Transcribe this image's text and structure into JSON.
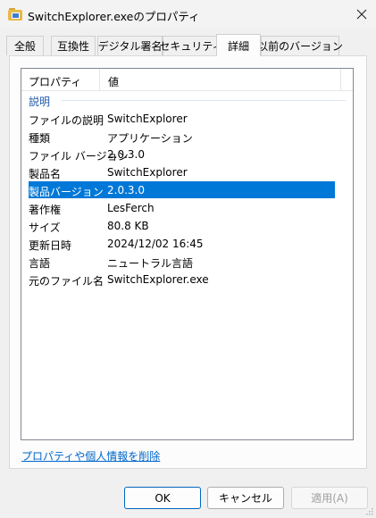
{
  "window": {
    "title": "SwitchExplorer.exeのプロパティ",
    "close_icon": "close-icon",
    "app_icon": "folder-app-icon"
  },
  "tabs": [
    {
      "label": "全般"
    },
    {
      "label": "互換性"
    },
    {
      "label": "デジタル署名"
    },
    {
      "label": "セキュリティ"
    },
    {
      "label": "詳細",
      "active": true
    },
    {
      "label": "以前のバージョン"
    }
  ],
  "details": {
    "header": {
      "property": "プロパティ",
      "value": "値"
    },
    "group": "説明",
    "rows": [
      {
        "key": "ファイルの説明",
        "value": "SwitchExplorer"
      },
      {
        "key": "種類",
        "value": "アプリケーション"
      },
      {
        "key": "ファイル バージョン",
        "value": "2.0.3.0"
      },
      {
        "key": "製品名",
        "value": "SwitchExplorer"
      },
      {
        "key": "製品バージョン",
        "value": "2.0.3.0",
        "selected": true
      },
      {
        "key": "著作権",
        "value": "LesFerch"
      },
      {
        "key": "サイズ",
        "value": "80.8 KB"
      },
      {
        "key": "更新日時",
        "value": "2024/12/02 16:45"
      },
      {
        "key": "言語",
        "value": "ニュートラル言語"
      },
      {
        "key": "元のファイル名",
        "value": "SwitchExplorer.exe"
      }
    ]
  },
  "remove_link": "プロパティや個人情報を削除",
  "buttons": {
    "ok": "OK",
    "cancel": "キャンセル",
    "apply": "適用(A)"
  },
  "colors": {
    "selection": "#0078d7",
    "link": "#0066cc",
    "group": "#1e5aa8"
  }
}
